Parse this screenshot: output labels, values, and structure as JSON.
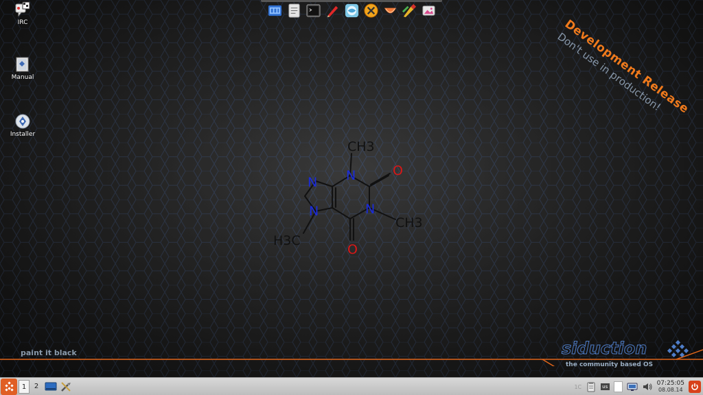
{
  "desktop": {
    "icons": [
      {
        "label": "IRC",
        "icon": "irc-chat-icon"
      },
      {
        "label": "Manual",
        "icon": "manual-book-icon"
      },
      {
        "label": "Installer",
        "icon": "installer-disc-icon"
      }
    ]
  },
  "dock": {
    "items": [
      {
        "name": "file-manager-icon"
      },
      {
        "name": "text-editor-icon"
      },
      {
        "name": "terminal-icon"
      },
      {
        "name": "paint-brush-icon"
      },
      {
        "name": "web-browser-icon"
      },
      {
        "name": "x-close-icon"
      },
      {
        "name": "melon-game-icon"
      },
      {
        "name": "graphics-editor-icon"
      },
      {
        "name": "image-viewer-icon"
      }
    ]
  },
  "wallpaper": {
    "banner_title": "Development Release",
    "banner_subtitle": "Don't use in production!",
    "motto": "paint it black",
    "brand_name": "siduction",
    "brand_tagline": "the community based OS",
    "molecule_labels": {
      "ch3_top": "CH3",
      "ch3_right": "CH3",
      "h3c_left": "H3C",
      "n1": "N",
      "n2": "N",
      "n3": "N",
      "n4": "N",
      "o1": "O",
      "o2": "O"
    },
    "colors": {
      "accent": "#f07a1c",
      "nitrogen": "#1a2bdc",
      "oxygen": "#d81818",
      "hex_line": "#3c4a66"
    }
  },
  "taskbar": {
    "workspaces": [
      "1",
      "2"
    ],
    "active_workspace": "1",
    "tray": {
      "cpu_label": "1C",
      "keyboard_layout": "us",
      "time": "07:25:05",
      "date": "08.08.14"
    }
  }
}
